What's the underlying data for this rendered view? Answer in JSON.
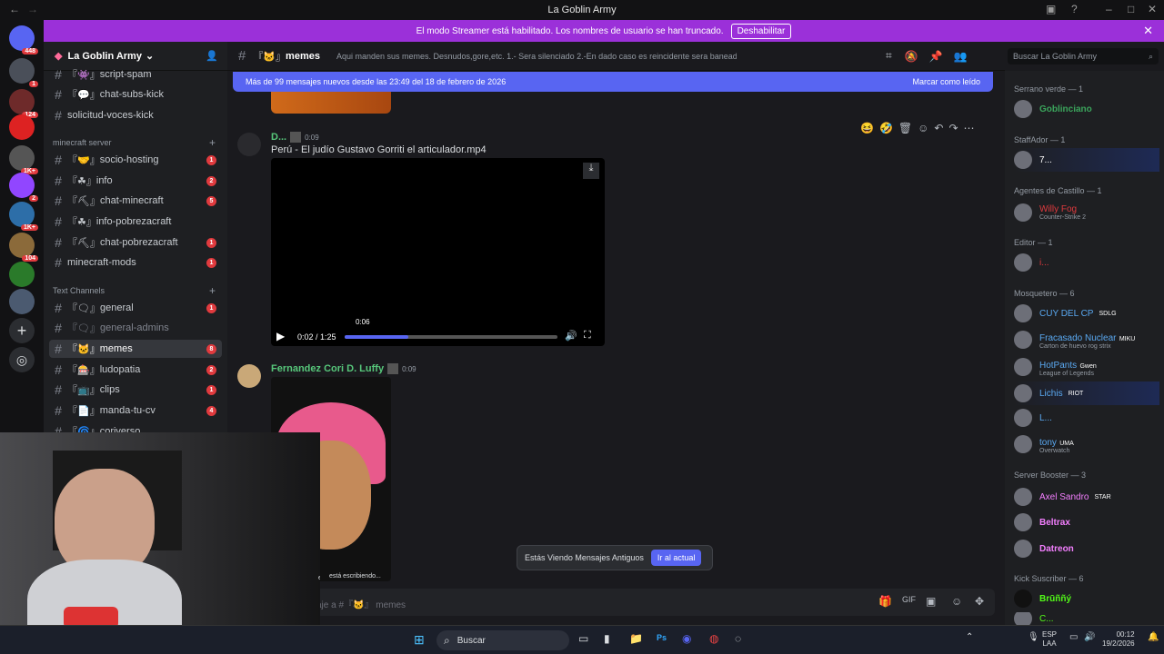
{
  "window": {
    "title": "La Goblin Army"
  },
  "banner": {
    "text": "El modo Streamer está habilitado. Los nombres de usuario se han truncado.",
    "button": "Deshabilitar"
  },
  "server": {
    "name": "La Goblin Army"
  },
  "server_badges": [
    "448",
    "1",
    "124",
    "1K+",
    "2",
    "1K+",
    "104"
  ],
  "channels_top": [
    {
      "label": "script-spam",
      "badge": "",
      "prefix": "『👾』"
    },
    {
      "label": "chat-subs-kick",
      "badge": "",
      "prefix": "『💬』"
    },
    {
      "label": "solicitud-voces-kick",
      "badge": "",
      "prefix": ""
    }
  ],
  "categories": {
    "minecraft": "minecraft server",
    "text": "Text Channels"
  },
  "channels_mc": [
    {
      "label": "socio-hosting",
      "badge": "1",
      "prefix": "『🤝』"
    },
    {
      "label": "info",
      "badge": "2",
      "prefix": "『☘』"
    },
    {
      "label": "chat-minecraft",
      "badge": "5",
      "prefix": "『⛏』"
    },
    {
      "label": "info-pobrezacraft",
      "badge": "",
      "prefix": "『☘』"
    },
    {
      "label": "chat-pobrezacraft",
      "badge": "1",
      "prefix": "『⛏』"
    },
    {
      "label": "minecraft-mods",
      "badge": "1",
      "prefix": ""
    }
  ],
  "channels_text": [
    {
      "label": "general",
      "badge": "1",
      "prefix": "『🗨』"
    },
    {
      "label": "general-admins",
      "badge": "",
      "prefix": "『🗨』"
    },
    {
      "label": "memes",
      "badge": "8",
      "prefix": "『🐱』"
    },
    {
      "label": "ludopatia",
      "badge": "2",
      "prefix": "『🎰』"
    },
    {
      "label": "clips",
      "badge": "1",
      "prefix": "『📺』"
    },
    {
      "label": "manda-tu-cv",
      "badge": "4",
      "prefix": "『📄』"
    },
    {
      "label": "coriverso",
      "badge": "",
      "prefix": "『🌀』"
    }
  ],
  "header": {
    "channel": "memes",
    "prefix": "『🐱』",
    "topic": "Aqui manden sus memes. Desnudos,gore,etc. 1.- Sera silenciado 2.-En dado caso es reincidente sera baneado",
    "search_placeholder": "Buscar La Goblin Army"
  },
  "newbar": {
    "text": "Más de 99 mensajes nuevos desde las 23:49 del 18 de febrero de 2026",
    "action": "Marcar como leído"
  },
  "message1": {
    "author": "D...",
    "time": "0:09",
    "file": "Perú - El judío Gustavo Gorriti el articulador.mp4",
    "tooltip": "0:06",
    "timecode": "0:02 / 1:25",
    "progress": 0.3
  },
  "message2": {
    "author": "Fernandez Cori D. Luffy",
    "time": "0:09"
  },
  "old_bar": {
    "text": "Estás Viendo Mensajes Antiguos",
    "button": "Ir al actual"
  },
  "typing": "está escribiendo...",
  "composer": {
    "placeholder": "aje a #『🐱』 memes"
  },
  "members": {
    "groups": [
      {
        "header": "Serrano verde — 1"
      },
      {
        "header": "StaffAdor — 1"
      },
      {
        "header": "Agentes de Castillo — 1"
      },
      {
        "header": "Editor — 1"
      },
      {
        "header": "Mosquetero — 6"
      },
      {
        "header": "Server Booster — 3"
      },
      {
        "header": "Kick Suscriber — 6"
      }
    ],
    "people": [
      {
        "name": "Goblinciano",
        "sub": "",
        "tag": "",
        "color": "#3ba55c"
      },
      {
        "name": "7...",
        "sub": "",
        "tag": "",
        "color": "#ffffff"
      },
      {
        "name": "Willy Fog",
        "sub": "Counter-Strike 2",
        "tag": "",
        "color": "#e03a3e"
      },
      {
        "name": "i...",
        "sub": "",
        "tag": "",
        "color": "#e03a3e"
      },
      {
        "name": "CUY DEL CP",
        "sub": "",
        "tag": "SDLG",
        "color": "#5aa9f2"
      },
      {
        "name": "Fracasado Nuclear",
        "sub": "Carton de huevo rog strix",
        "tag": "MIKU",
        "color": "#5aa9f2"
      },
      {
        "name": "HotPants",
        "sub": "League of Legends",
        "tag": "Gwen",
        "color": "#5aa9f2"
      },
      {
        "name": "Lichis",
        "sub": "",
        "tag": "RIOT",
        "color": "#5aa9f2"
      },
      {
        "name": "L...",
        "sub": "",
        "tag": "",
        "color": "#5aa9f2"
      },
      {
        "name": "tony",
        "sub": "Overwatch",
        "tag": "UMA",
        "color": "#5aa9f2"
      },
      {
        "name": "Axel Sandro",
        "sub": "",
        "tag": "STAR",
        "color": "#f47fff"
      },
      {
        "name": "Beltrax",
        "sub": "",
        "tag": "",
        "color": "#f47fff"
      },
      {
        "name": "Datreon",
        "sub": "",
        "tag": "",
        "color": "#f47fff"
      },
      {
        "name": "Brūññý",
        "sub": "",
        "tag": "",
        "color": "#53fc18"
      },
      {
        "name": "C...",
        "sub": "",
        "tag": "",
        "color": "#53fc18"
      }
    ]
  },
  "taskbar": {
    "search": "Buscar",
    "lang": "ESP",
    "region": "LAA",
    "time": "00:12",
    "date": "19/2/2026"
  }
}
